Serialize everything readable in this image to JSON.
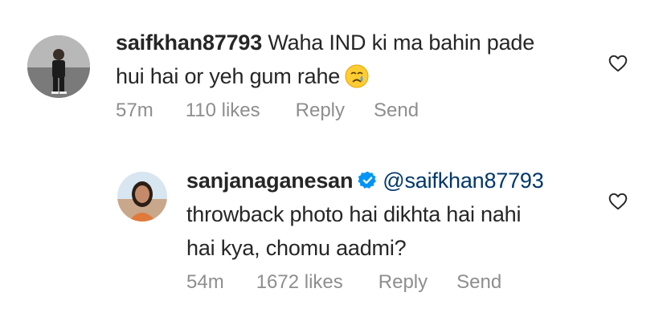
{
  "comments": [
    {
      "username": "saifkhan87793",
      "text_line1": "Waha IND ki ma bahin pade",
      "text_line2": "hui hai or yeh gum rahe",
      "emoji": "crying-face-icon",
      "time": "57m",
      "likes": "110 likes",
      "reply_label": "Reply",
      "send_label": "Send",
      "verified": false
    },
    {
      "username": "sanjanaganesan",
      "mention": "@saifkhan87793",
      "text_line1": "throwback photo hai dikhta hai nahi",
      "text_line2": "hai kya, chomu aadmi?",
      "time": "54m",
      "likes": "1672 likes",
      "reply_label": "Reply",
      "send_label": "Send",
      "verified": true
    }
  ],
  "colors": {
    "text": "#262626",
    "meta": "#8e8e8e",
    "mention": "#00376b",
    "verified_badge": "#0095f6"
  }
}
